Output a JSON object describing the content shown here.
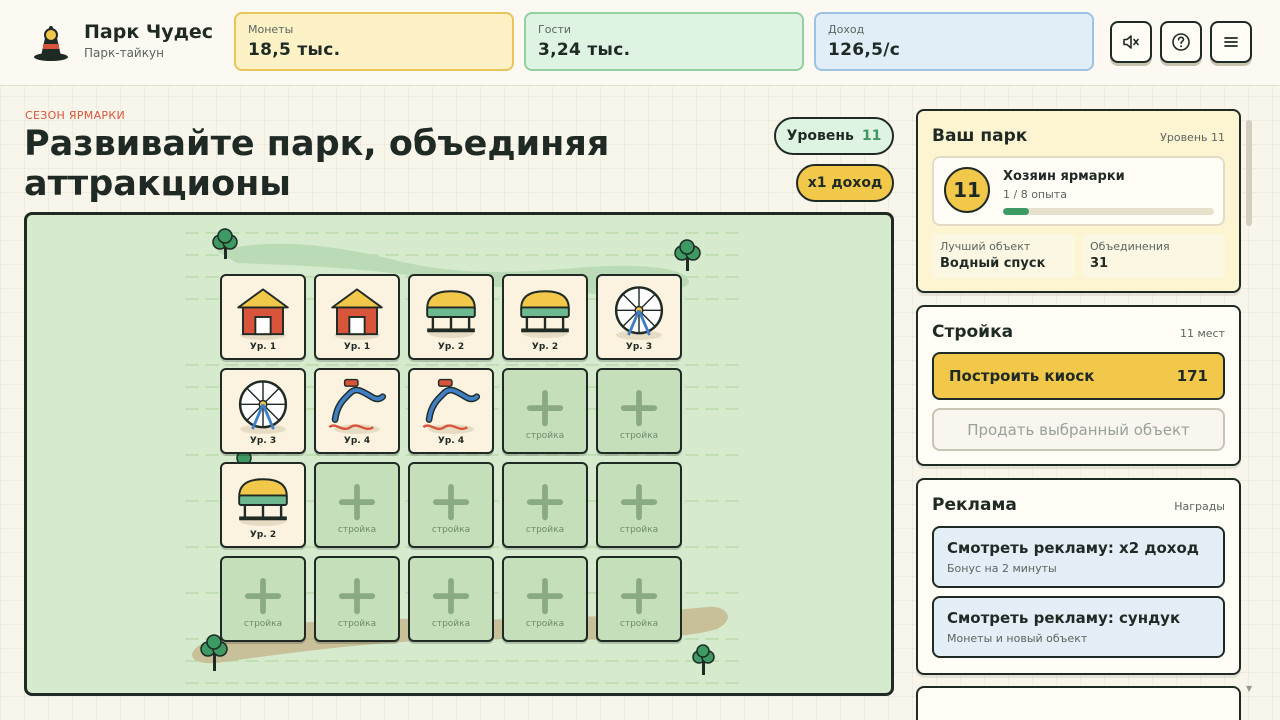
{
  "header": {
    "title": "Парк Чудес",
    "subtitle": "Парк-тайкун",
    "stats": {
      "coins": {
        "label": "Монеты",
        "value": "18,5 тыс."
      },
      "guests": {
        "label": "Гости",
        "value": "3,24 тыс."
      },
      "income": {
        "label": "Доход",
        "value": "126,5/с"
      }
    },
    "buttons": [
      "mute-icon",
      "help-icon",
      "menu-icon"
    ]
  },
  "main": {
    "season": "СЕЗОН ЯРМАРКИ",
    "headline": "Развивайте парк, объединяя аттракционы",
    "level_label": "Уровень",
    "level_value": "11",
    "multiplier": "x1 доход"
  },
  "board": {
    "tiles": [
      {
        "type": "kiosk",
        "label": "Ур. 1"
      },
      {
        "type": "kiosk",
        "label": "Ур. 1"
      },
      {
        "type": "carousel",
        "label": "Ур. 2"
      },
      {
        "type": "carousel",
        "label": "Ур. 2"
      },
      {
        "type": "ferris",
        "label": "Ур. 3"
      },
      {
        "type": "ferris",
        "label": "Ур. 3"
      },
      {
        "type": "slide",
        "label": "Ур. 4"
      },
      {
        "type": "slide",
        "label": "Ур. 4"
      },
      {
        "type": "empty",
        "label": "стройка"
      },
      {
        "type": "empty",
        "label": "стройка"
      },
      {
        "type": "carousel",
        "label": "Ур. 2"
      },
      {
        "type": "empty",
        "label": "стройка"
      },
      {
        "type": "empty",
        "label": "стройка"
      },
      {
        "type": "empty",
        "label": "стройка"
      },
      {
        "type": "empty",
        "label": "стройка"
      },
      {
        "type": "empty",
        "label": "стройка"
      },
      {
        "type": "empty",
        "label": "стройка"
      },
      {
        "type": "empty",
        "label": "стройка"
      },
      {
        "type": "empty",
        "label": "стройка"
      },
      {
        "type": "empty",
        "label": "стройка"
      }
    ]
  },
  "sidebar": {
    "park": {
      "title": "Ваш парк",
      "level_text": "Уровень 11",
      "badge": "11",
      "owner_title": "Хозяин ярмарки",
      "exp_text": "1 / 8 опыта",
      "exp_fraction": 0.125,
      "best_label": "Лучший объект",
      "best_value": "Водный спуск",
      "merges_label": "Объединения",
      "merges_value": "31"
    },
    "build": {
      "title": "Стройка",
      "places": "11 мест",
      "build_label": "Построить киоск",
      "build_cost": "171",
      "sell_label": "Продать выбранный объект"
    },
    "ads": {
      "title": "Реклама",
      "aside": "Награды",
      "items": [
        {
          "title": "Смотреть рекламу: x2 доход",
          "subtitle": "Бонус на 2 минуты"
        },
        {
          "title": "Смотреть рекламу: сундук",
          "subtitle": "Монеты и новый объект"
        }
      ]
    }
  },
  "colors": {
    "accent_yellow": "#f2c84b",
    "accent_green": "#3d9a63",
    "board_bg": "#d6ebcd",
    "outline": "#1f2a25",
    "season_red": "#d8553c"
  }
}
